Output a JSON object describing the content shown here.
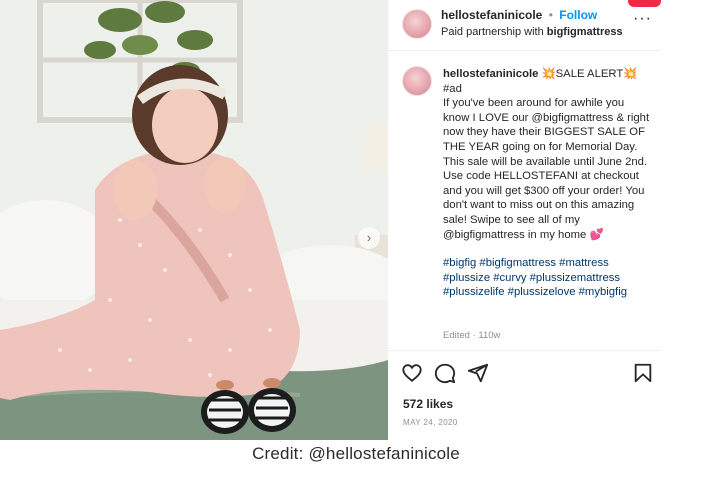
{
  "header": {
    "username": "hellostefaninicole",
    "separator": "•",
    "follow_label": "Follow",
    "subtitle_prefix": "Paid partnership with",
    "partner": "bigfigmattress",
    "more_icon": "more-icon"
  },
  "caption": {
    "username": "hellostefaninicole",
    "lines": [
      "💥SALE ALERT💥",
      "#ad",
      "If you've been around for awhile you know I LOVE our @bigfigmattress & right now they have their BIGGEST SALE OF THE YEAR going on for Memorial Day. This sale will be available until June 2nd.",
      "Use code HELLOSTEFANI at checkout and you will get $300 off your order! You don't want to miss out on this amazing sale! Swipe to see all of my @bigfigmattress in my home 💕"
    ],
    "hashtags": "#bigfig #bigfigmattress #mattress #plussize #curvy #plussizemattress #plussizelife #plussizelove #mybigfig",
    "edited": "Edited · 110w"
  },
  "actions": {
    "like_icon": "heart-icon",
    "comment_icon": "comment-icon",
    "share_icon": "share-icon",
    "save_icon": "bookmark-icon"
  },
  "likes": "572 likes",
  "date": "MAY 24, 2020",
  "credit": "Credit: @hellostefaninicole",
  "colors": {
    "follow": "#0095f6",
    "hashtag": "#00376b",
    "accent_red": "#ed2b49"
  }
}
